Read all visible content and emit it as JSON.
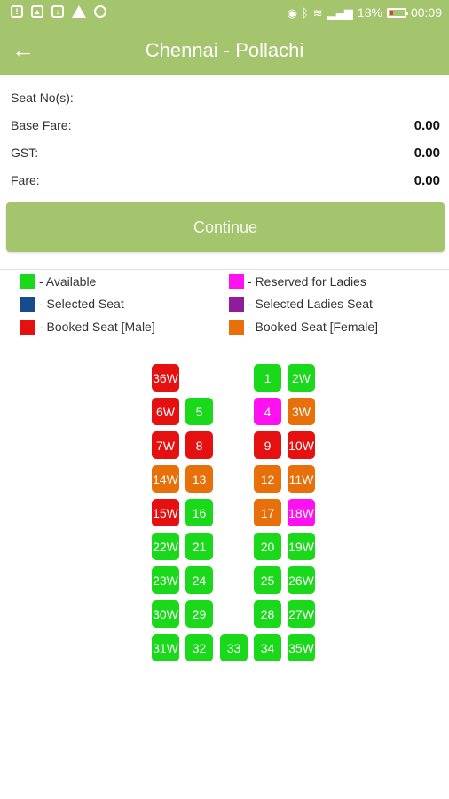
{
  "status_bar": {
    "battery": "18%",
    "time": "00:09"
  },
  "header": {
    "title": "Chennai - Pollachi"
  },
  "summary": {
    "seat_label": "Seat No(s):",
    "seat_value": "",
    "base_fare_label": "Base Fare:",
    "base_fare_value": "0.00",
    "gst_label": "GST:",
    "gst_value": "0.00",
    "fare_label": "Fare:",
    "fare_value": "0.00"
  },
  "continue_label": "Continue",
  "colors": {
    "available": "#1ad81a",
    "selected": "#174b8f",
    "booked_male": "#e51010",
    "reserved_ladies": "#ff10f0",
    "selected_ladies": "#8f1c9a",
    "booked_female": "#e8700a",
    "accent": "#a5c46e"
  },
  "legend": [
    {
      "label": "- Available",
      "status": "available"
    },
    {
      "label": "- Reserved for Ladies",
      "status": "reserved_ladies"
    },
    {
      "label": "- Selected Seat",
      "status": "selected"
    },
    {
      "label": "- Selected Ladies Seat",
      "status": "selected_ladies"
    },
    {
      "label": "- Booked Seat [Male]",
      "status": "booked_male"
    },
    {
      "label": "- Booked Seat [Female]",
      "status": "booked_female"
    }
  ],
  "seats": [
    {
      "label": "36W",
      "status": "booked_male"
    },
    {
      "label": "1",
      "status": "available"
    },
    {
      "label": "2W",
      "status": "available"
    },
    {
      "label": "6W",
      "status": "booked_male"
    },
    {
      "label": "5",
      "status": "available"
    },
    {
      "label": "4",
      "status": "reserved_ladies"
    },
    {
      "label": "3W",
      "status": "booked_female"
    },
    {
      "label": "7W",
      "status": "booked_male"
    },
    {
      "label": "8",
      "status": "booked_male"
    },
    {
      "label": "9",
      "status": "booked_male"
    },
    {
      "label": "10W",
      "status": "booked_male"
    },
    {
      "label": "14W",
      "status": "booked_female"
    },
    {
      "label": "13",
      "status": "booked_female"
    },
    {
      "label": "12",
      "status": "booked_female"
    },
    {
      "label": "11W",
      "status": "booked_female"
    },
    {
      "label": "15W",
      "status": "booked_male"
    },
    {
      "label": "16",
      "status": "available"
    },
    {
      "label": "17",
      "status": "booked_female"
    },
    {
      "label": "18W",
      "status": "reserved_ladies"
    },
    {
      "label": "22W",
      "status": "available"
    },
    {
      "label": "21",
      "status": "available"
    },
    {
      "label": "20",
      "status": "available"
    },
    {
      "label": "19W",
      "status": "available"
    },
    {
      "label": "23W",
      "status": "available"
    },
    {
      "label": "24",
      "status": "available"
    },
    {
      "label": "25",
      "status": "available"
    },
    {
      "label": "26W",
      "status": "available"
    },
    {
      "label": "30W",
      "status": "available"
    },
    {
      "label": "29",
      "status": "available"
    },
    {
      "label": "28",
      "status": "available"
    },
    {
      "label": "27W",
      "status": "available"
    },
    {
      "label": "31W",
      "status": "available"
    },
    {
      "label": "32",
      "status": "available"
    },
    {
      "label": "33",
      "status": "available"
    },
    {
      "label": "34",
      "status": "available"
    },
    {
      "label": "35W",
      "status": "available"
    }
  ]
}
